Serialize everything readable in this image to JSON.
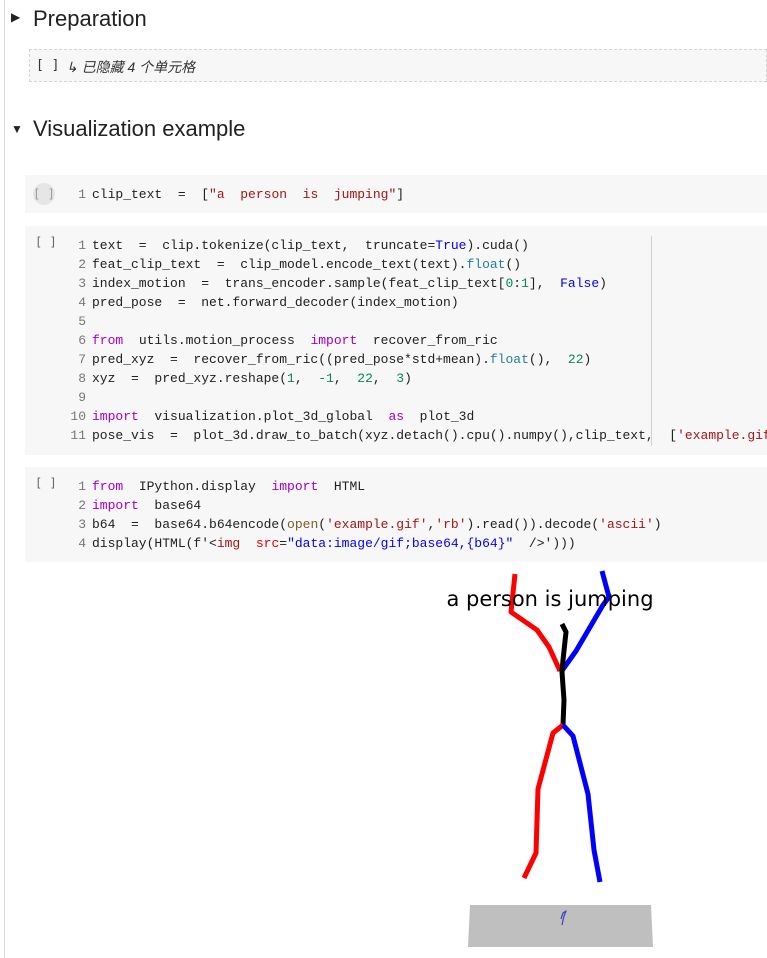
{
  "sections": [
    {
      "title": "Preparation",
      "collapsed": true,
      "toggle_icon": "triangle-right"
    },
    {
      "title": "Visualization example",
      "collapsed": false,
      "toggle_icon": "triangle-down"
    }
  ],
  "hidden_cells": {
    "bracket": "[ ]",
    "label": "↳ 已隐藏 4 个单元格"
  },
  "cells": [
    {
      "run_label": "[ ]",
      "lines": [
        [
          [
            "clip_text  =  [",
            ""
          ],
          [
            "\"a  person  is  jumping\"",
            "str"
          ],
          [
            "]",
            ""
          ]
        ]
      ]
    },
    {
      "run_label": "[ ]",
      "lines": [
        [
          [
            "text  =  clip.tokenize(clip_text,  truncate=",
            ""
          ],
          [
            "True",
            "bool"
          ],
          [
            ").cuda()",
            ""
          ]
        ],
        [
          [
            "feat_clip_text  =  clip_model.encode_text(text).",
            ""
          ],
          [
            "float",
            "fn"
          ],
          [
            "()",
            ""
          ]
        ],
        [
          [
            "index_motion  =  trans_encoder.sample(feat_clip_text[",
            ""
          ],
          [
            "0",
            "num"
          ],
          [
            ":",
            ""
          ],
          [
            "1",
            "num"
          ],
          [
            "],  ",
            ""
          ],
          [
            "False",
            "bool"
          ],
          [
            ")",
            ""
          ]
        ],
        [
          [
            "pred_pose  =  net.forward_decoder(index_motion)",
            ""
          ]
        ],
        [],
        [
          [
            "from",
            "kw"
          ],
          [
            "  utils.motion_process  ",
            ""
          ],
          [
            "import",
            "kw"
          ],
          [
            "  recover_from_ric",
            ""
          ]
        ],
        [
          [
            "pred_xyz  =  recover_from_ric((pred_pose*std+mean).",
            ""
          ],
          [
            "float",
            "fn"
          ],
          [
            "(),  ",
            ""
          ],
          [
            "22",
            "num"
          ],
          [
            ")",
            ""
          ]
        ],
        [
          [
            "xyz  =  pred_xyz.reshape(",
            ""
          ],
          [
            "1",
            "num"
          ],
          [
            ",  ",
            ""
          ],
          [
            "-1",
            "num"
          ],
          [
            ",  ",
            ""
          ],
          [
            "22",
            "num"
          ],
          [
            ",  ",
            ""
          ],
          [
            "3",
            "num"
          ],
          [
            ")",
            ""
          ]
        ],
        [],
        [
          [
            "import",
            "kw"
          ],
          [
            "  visualization.plot_3d_global  ",
            ""
          ],
          [
            "as",
            "kw"
          ],
          [
            "  plot_3d",
            ""
          ]
        ],
        [
          [
            "pose_vis  =  plot_3d.draw_to_batch(xyz.detach().cpu().numpy(),clip_text,  [",
            ""
          ],
          [
            "'example.gif'",
            "str"
          ],
          [
            "])",
            ""
          ]
        ]
      ]
    },
    {
      "run_label": "[ ]",
      "lines": [
        [
          [
            "from",
            "kw"
          ],
          [
            "  IPython.display  ",
            ""
          ],
          [
            "import",
            "kw"
          ],
          [
            "  HTML",
            ""
          ]
        ],
        [
          [
            "import",
            "kw"
          ],
          [
            "  base64",
            ""
          ]
        ],
        [
          [
            "b64  =  base64.b64encode(",
            ""
          ],
          [
            "open",
            "bi"
          ],
          [
            "(",
            ""
          ],
          [
            "'example.gif'",
            "str"
          ],
          [
            ",",
            ""
          ],
          [
            "'rb'",
            "str"
          ],
          [
            ").read()).decode(",
            ""
          ],
          [
            "'ascii'",
            "str"
          ],
          [
            ")",
            ""
          ]
        ],
        [
          [
            "display(HTML(f'<",
            ""
          ],
          [
            "img",
            "str"
          ],
          [
            "  ",
            ""
          ],
          [
            "src",
            "attr"
          ],
          [
            "=",
            ""
          ],
          [
            "\"data:image/gif;base64,{b64}\"",
            "fs"
          ],
          [
            "  />')",
            ""
          ],
          [
            "))",
            ""
          ]
        ]
      ]
    }
  ],
  "output": {
    "caption": "a person is jumping",
    "colors": {
      "left": "#ff0000",
      "right": "#0000ff",
      "spine": "#000000",
      "floor": "#bfbfbf"
    }
  }
}
